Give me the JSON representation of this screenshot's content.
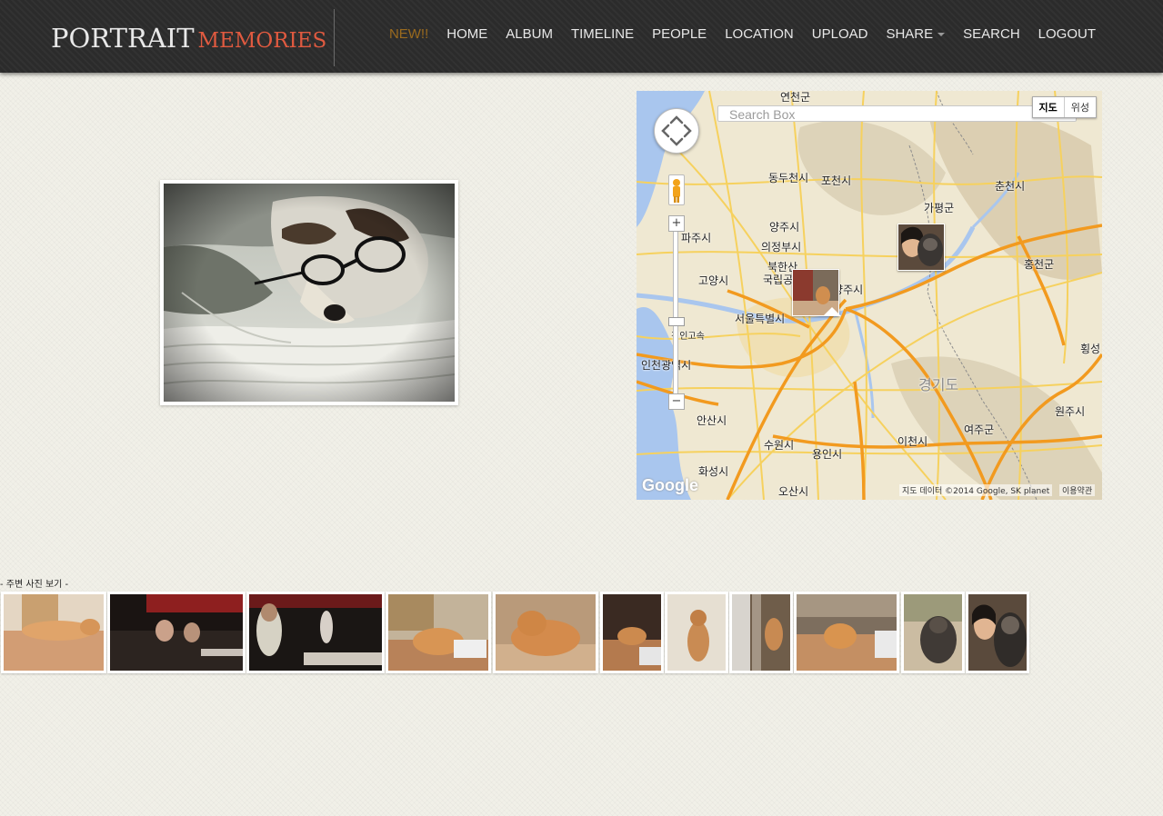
{
  "brand": {
    "main": "PORTRAIT",
    "sub": "MEMORIES"
  },
  "nav": {
    "items": [
      {
        "label": "NEW!!"
      },
      {
        "label": "HOME"
      },
      {
        "label": "ALBUM"
      },
      {
        "label": "TIMELINE"
      },
      {
        "label": "PEOPLE"
      },
      {
        "label": "LOCATION"
      },
      {
        "label": "UPLOAD"
      },
      {
        "label": "SHARE"
      },
      {
        "label": "SEARCH"
      },
      {
        "label": "LOGOUT"
      }
    ],
    "highlight_color": "#9a6a1e"
  },
  "main_photo": {
    "subject": "dog wearing glasses on blanket"
  },
  "map": {
    "search_placeholder": "Search Box",
    "type_buttons": [
      "지도",
      "위성"
    ],
    "labels": [
      "연천군",
      "양주시",
      "포천시",
      "동두천시",
      "가평군",
      "춘천시",
      "파주시",
      "의정부시",
      "북한산",
      "국립공원",
      "고양시",
      "남양주시",
      "서울특별시",
      "홍천군",
      "인천광역시",
      "경기도",
      "안산시",
      "수원시",
      "용인시",
      "이천시",
      "여주군",
      "원주시",
      "화성시",
      "오산시",
      "경인고속",
      "횡성"
    ],
    "google": "Google",
    "copyright": "지도 데이터 ©2014 Google, SK planet",
    "terms": "이용약관"
  },
  "nearby": {
    "label": "- 주변 사진 보기 -"
  },
  "colors": {
    "navbar": "#2b2b2b",
    "brand_accent": "#e05a40",
    "background": "#f1f0e8"
  }
}
